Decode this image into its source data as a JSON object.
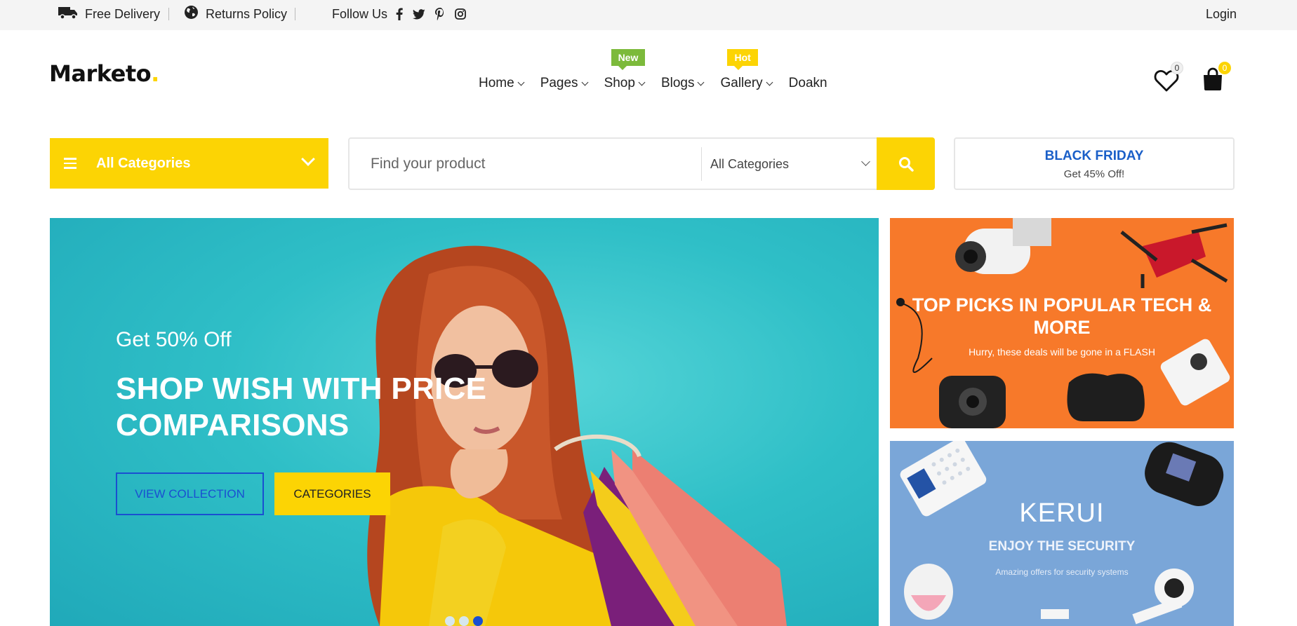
{
  "topbar": {
    "delivery": "Free Delivery",
    "returns": "Returns Policy",
    "follow": "Follow Us",
    "login": "Login",
    "social_icons": [
      "facebook-icon",
      "twitter-icon",
      "pinterest-icon",
      "instagram-icon"
    ]
  },
  "logo": {
    "text": "Marketo",
    "dot": "."
  },
  "nav": {
    "items": [
      {
        "label": "Home"
      },
      {
        "label": "Pages"
      },
      {
        "label": "Shop",
        "badge": "New"
      },
      {
        "label": "Blogs"
      },
      {
        "label": "Gallery",
        "badge": "Hot"
      },
      {
        "label": "Doakn"
      }
    ]
  },
  "header": {
    "wishlist_count": "0",
    "cart_count": "0"
  },
  "categories": {
    "label": "All Categories"
  },
  "search": {
    "placeholder": "Find your product",
    "category_selected": "All Categories"
  },
  "promo": {
    "title": "BLACK FRIDAY",
    "subtitle": "Get 45% Off!"
  },
  "hero": {
    "subtitle": "Get 50% Off",
    "title": "SHOP WISH WITH PRICE COMPARISONS",
    "btn_view": "VIEW COLLECTION",
    "btn_categories": "CATEGORIES",
    "slides": 3,
    "active_slide": 3
  },
  "banner1": {
    "title": "TOP PICKS IN POPULAR TECH & MORE",
    "subtitle": "Hurry, these deals will be gone in a FLASH"
  },
  "banner2": {
    "brand": "KERUI",
    "title": "ENJOY THE SECURITY",
    "subtitle": "Amazing offers for security systems"
  },
  "colors": {
    "accent": "#fcd404",
    "brand_blue": "#1a4fd1",
    "new_badge": "#7cba3b",
    "banner_orange": "#f7792a"
  }
}
